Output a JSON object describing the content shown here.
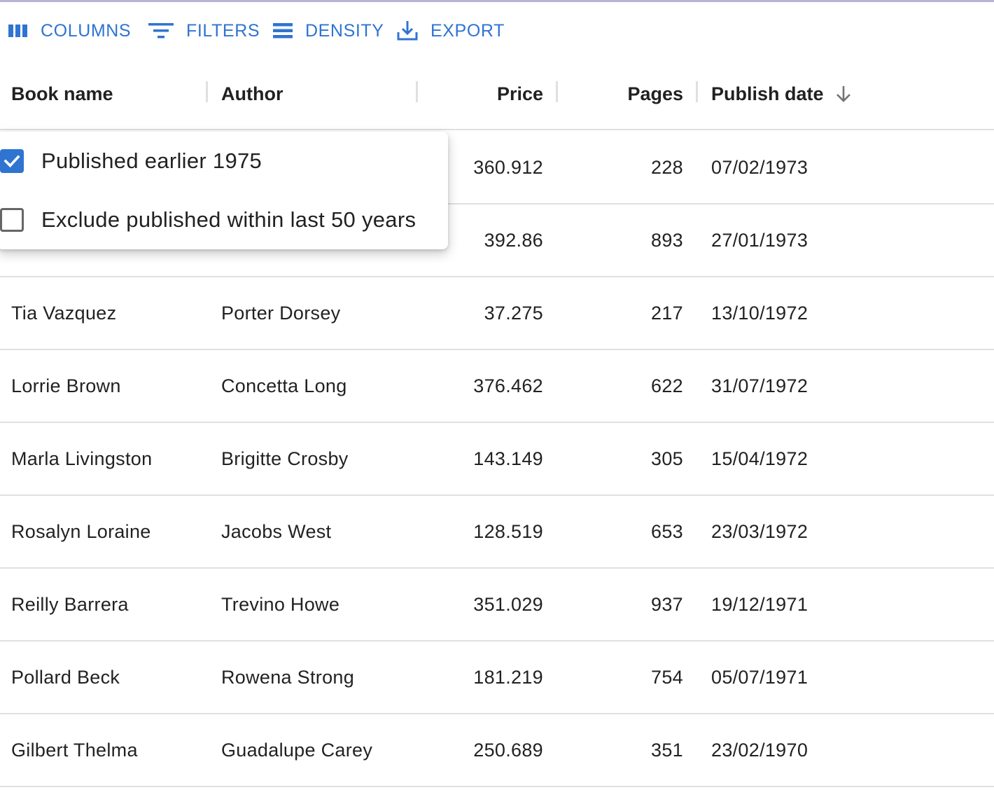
{
  "toolbar": {
    "columns_label": "COLUMNS",
    "filters_label": "FILTERS",
    "density_label": "DENSITY",
    "export_label": "EXPORT"
  },
  "columns": {
    "book_name": "Book name",
    "author": "Author",
    "price": "Price",
    "pages": "Pages",
    "publish_date": "Publish date"
  },
  "sort": {
    "column": "Publish date",
    "direction": "descending",
    "icon": "arrow-down-icon"
  },
  "filter_popover": {
    "options": [
      {
        "label": "Published earlier 1975",
        "checked": true
      },
      {
        "label": "Exclude published within last 50 years",
        "checked": false
      }
    ]
  },
  "rows": [
    {
      "book": "",
      "author": "",
      "price": "360.912",
      "pages": "228",
      "date": "07/02/1973"
    },
    {
      "book": "",
      "author": "",
      "price": "392.86",
      "pages": "893",
      "date": "27/01/1973"
    },
    {
      "book": "Tia Vazquez",
      "author": "Porter Dorsey",
      "price": "37.275",
      "pages": "217",
      "date": "13/10/1972"
    },
    {
      "book": "Lorrie Brown",
      "author": "Concetta Long",
      "price": "376.462",
      "pages": "622",
      "date": "31/07/1972"
    },
    {
      "book": "Marla Livingston",
      "author": "Brigitte Crosby",
      "price": "143.149",
      "pages": "305",
      "date": "15/04/1972"
    },
    {
      "book": "Rosalyn Loraine",
      "author": "Jacobs West",
      "price": "128.519",
      "pages": "653",
      "date": "23/03/1972"
    },
    {
      "book": "Reilly Barrera",
      "author": "Trevino Howe",
      "price": "351.029",
      "pages": "937",
      "date": "19/12/1971"
    },
    {
      "book": "Pollard Beck",
      "author": "Rowena Strong",
      "price": "181.219",
      "pages": "754",
      "date": "05/07/1971"
    },
    {
      "book": "Gilbert Thelma",
      "author": "Guadalupe Carey",
      "price": "250.689",
      "pages": "351",
      "date": "23/02/1970"
    }
  ],
  "colors": {
    "accent": "#2f74d0",
    "divider": "#e0e0e0"
  }
}
